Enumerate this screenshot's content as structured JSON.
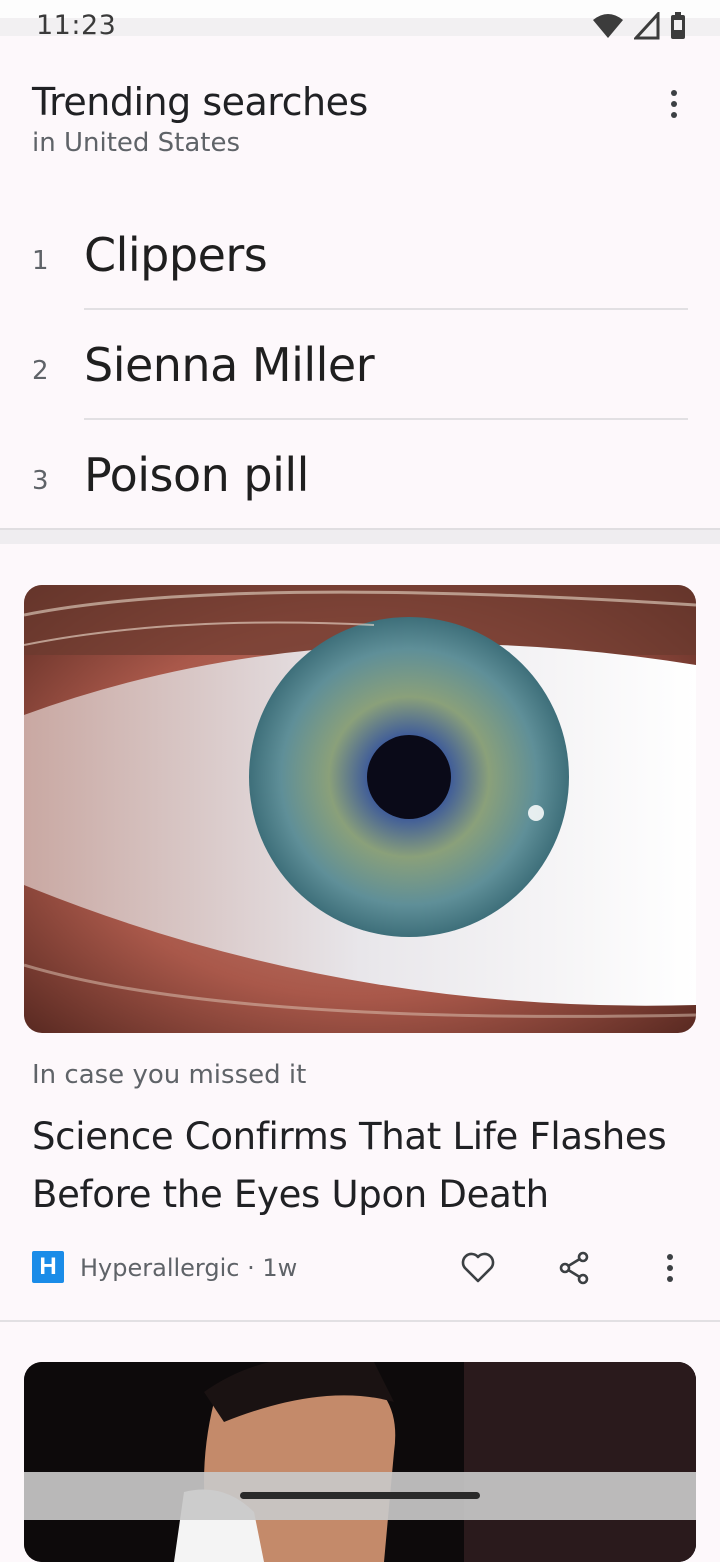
{
  "status_bar": {
    "time": "11:23",
    "icons": [
      "wifi-icon",
      "signal-icon",
      "battery-icon"
    ]
  },
  "trending": {
    "title": "Trending searches",
    "subtitle": "in United States",
    "items": [
      {
        "rank": "1",
        "label": "Clippers"
      },
      {
        "rank": "2",
        "label": "Sienna Miller"
      },
      {
        "rank": "3",
        "label": "Poison pill"
      }
    ]
  },
  "article": {
    "category": "In case you missed it",
    "title": "Science Confirms That Life Flashes Before the Eyes Upon Death",
    "source_logo": "H",
    "source": "Hyperallergic · 1w",
    "accent_color": "#1a8ce8"
  }
}
